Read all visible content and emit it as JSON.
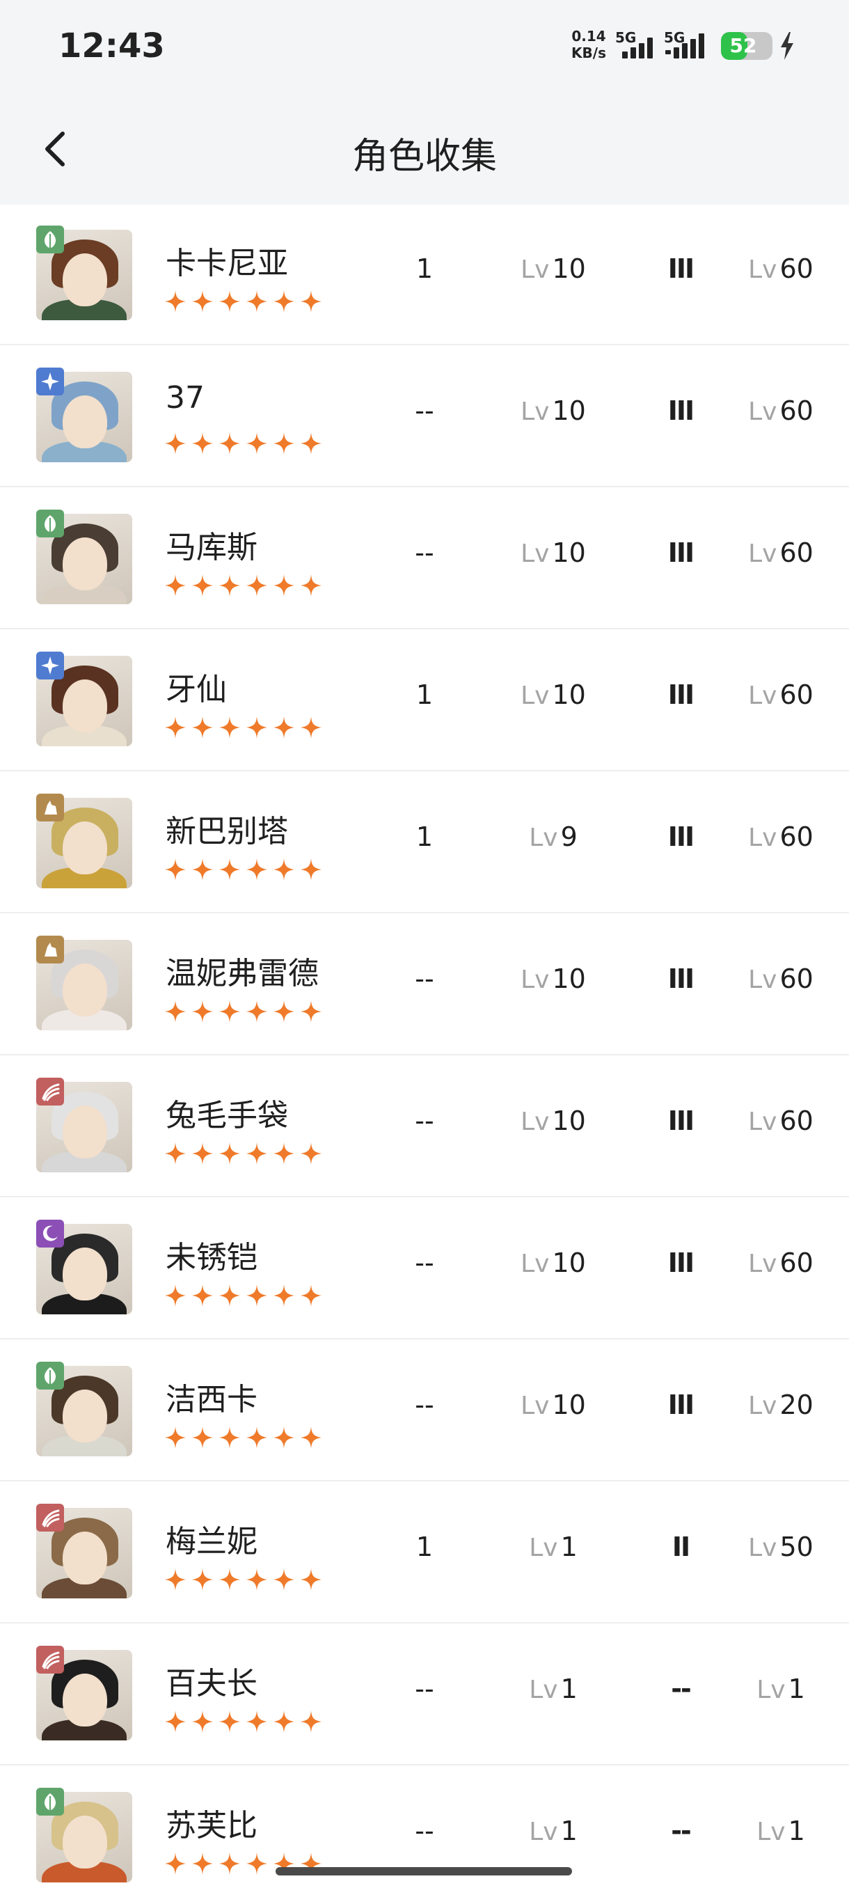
{
  "status_bar": {
    "time": "12:43",
    "net_speed_value": "0.14",
    "net_speed_unit": "KB/s",
    "sim1_label": "5G",
    "sim2_label": "5G",
    "battery_percent": "52",
    "battery_level": 0.52,
    "charging_icon": "bolt-icon"
  },
  "header": {
    "title": "角色收集",
    "back_icon": "chevron-left-icon"
  },
  "level_prefix": "Lv",
  "characters": [
    {
      "name": "卡卡尼亚",
      "col1": "1",
      "level": "10",
      "rank": "III",
      "cap": "60",
      "stars": 6,
      "element": "leaf",
      "badge_color": "#5fa56b",
      "hair": "#6b3d24",
      "outfit": "#3d5a3e"
    },
    {
      "name": "37",
      "col1": "--",
      "level": "10",
      "rank": "III",
      "cap": "60",
      "stars": 6,
      "element": "star",
      "badge_color": "#4f7bd0",
      "hair": "#7fa3c8",
      "outfit": "#8ab0cc"
    },
    {
      "name": "马库斯",
      "col1": "--",
      "level": "10",
      "rank": "III",
      "cap": "60",
      "stars": 6,
      "element": "leaf",
      "badge_color": "#5fa56b",
      "hair": "#4a3d34",
      "outfit": "#d8cfc2"
    },
    {
      "name": "牙仙",
      "col1": "1",
      "level": "10",
      "rank": "III",
      "cap": "60",
      "stars": 6,
      "element": "star",
      "badge_color": "#4f7bd0",
      "hair": "#5a3222",
      "outfit": "#e9dfcf"
    },
    {
      "name": "新巴别塔",
      "col1": "1",
      "level": "9",
      "rank": "III",
      "cap": "60",
      "stars": 6,
      "element": "tower",
      "badge_color": "#b38a4e",
      "hair": "#c9b060",
      "outfit": "#caa23a"
    },
    {
      "name": "温妮弗雷德",
      "col1": "--",
      "level": "10",
      "rank": "III",
      "cap": "60",
      "stars": 6,
      "element": "tower",
      "badge_color": "#b38a4e",
      "hair": "#d9d6d6",
      "outfit": "#efe9e6"
    },
    {
      "name": "兔毛手袋",
      "col1": "--",
      "level": "10",
      "rank": "III",
      "cap": "60",
      "stars": 6,
      "element": "beast",
      "badge_color": "#c25f5f",
      "hair": "#e2e2e2",
      "outfit": "#d7d7d7"
    },
    {
      "name": "未锈铠",
      "col1": "--",
      "level": "10",
      "rank": "III",
      "cap": "60",
      "stars": 6,
      "element": "moon",
      "badge_color": "#8b4fb5",
      "hair": "#2a2a2a",
      "outfit": "#1c1c1c"
    },
    {
      "name": "洁西卡",
      "col1": "--",
      "level": "10",
      "rank": "III",
      "cap": "20",
      "stars": 6,
      "element": "leaf",
      "badge_color": "#5fa56b",
      "hair": "#4b3828",
      "outfit": "#d9d9d0"
    },
    {
      "name": "梅兰妮",
      "col1": "1",
      "level": "1",
      "rank": "II",
      "cap": "50",
      "stars": 6,
      "element": "beast",
      "badge_color": "#c25f5f",
      "hair": "#8a6a48",
      "outfit": "#6b4c36"
    },
    {
      "name": "百夫长",
      "col1": "--",
      "level": "1",
      "rank": "--",
      "cap": "1",
      "stars": 6,
      "element": "beast",
      "badge_color": "#c25f5f",
      "hair": "#1e1e1e",
      "outfit": "#3a2c24"
    },
    {
      "name": "苏芙比",
      "col1": "--",
      "level": "1",
      "rank": "--",
      "cap": "1",
      "stars": 6,
      "element": "leaf",
      "badge_color": "#5fa56b",
      "hair": "#d6c28a",
      "outfit": "#c95a2c"
    }
  ],
  "colors": {
    "star": "#ef7a2a",
    "header_bg": "#f4f5f7",
    "divider": "#eeeeee",
    "lv_prefix": "#a4a4a4"
  }
}
